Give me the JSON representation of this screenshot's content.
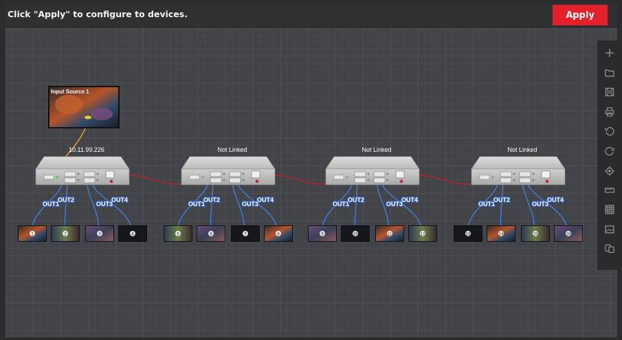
{
  "header": {
    "instruction": "Click \"Apply\" to configure to devices.",
    "apply_label": "Apply"
  },
  "input_source": {
    "label": "Input Source 1"
  },
  "devices": [
    {
      "status": "10.11.99.226",
      "outputs": [
        "OUT1",
        "OUT2",
        "OUT3",
        "OUT4"
      ],
      "screens": [
        "1",
        "2",
        "3",
        "4"
      ]
    },
    {
      "status": "Not Linked",
      "outputs": [
        "OUT1",
        "OUT2",
        "OUT3",
        "OUT4"
      ],
      "screens": [
        "5",
        "6",
        "7",
        "8"
      ]
    },
    {
      "status": "Not Linked",
      "outputs": [
        "OUT1",
        "OUT2",
        "OUT3",
        "OUT4"
      ],
      "screens": [
        "9",
        "10",
        "11",
        "12"
      ]
    },
    {
      "status": "Not Linked",
      "outputs": [
        "OUT1",
        "OUT2",
        "OUT3",
        "OUT4"
      ],
      "screens": [
        "13",
        "14",
        "15",
        "16"
      ]
    }
  ],
  "toolbar": [
    "add-icon",
    "open-folder-icon",
    "save-icon",
    "print-icon",
    "undo-icon",
    "redo-icon",
    "locate-icon",
    "ruler-icon",
    "grid-icon",
    "image-icon",
    "copy-icon"
  ],
  "colors": {
    "accent": "#e4202a",
    "link_input": "#f0a030",
    "link_cascade": "#b3242c",
    "link_output": "#3a7ee8",
    "canvas": "#434447"
  }
}
